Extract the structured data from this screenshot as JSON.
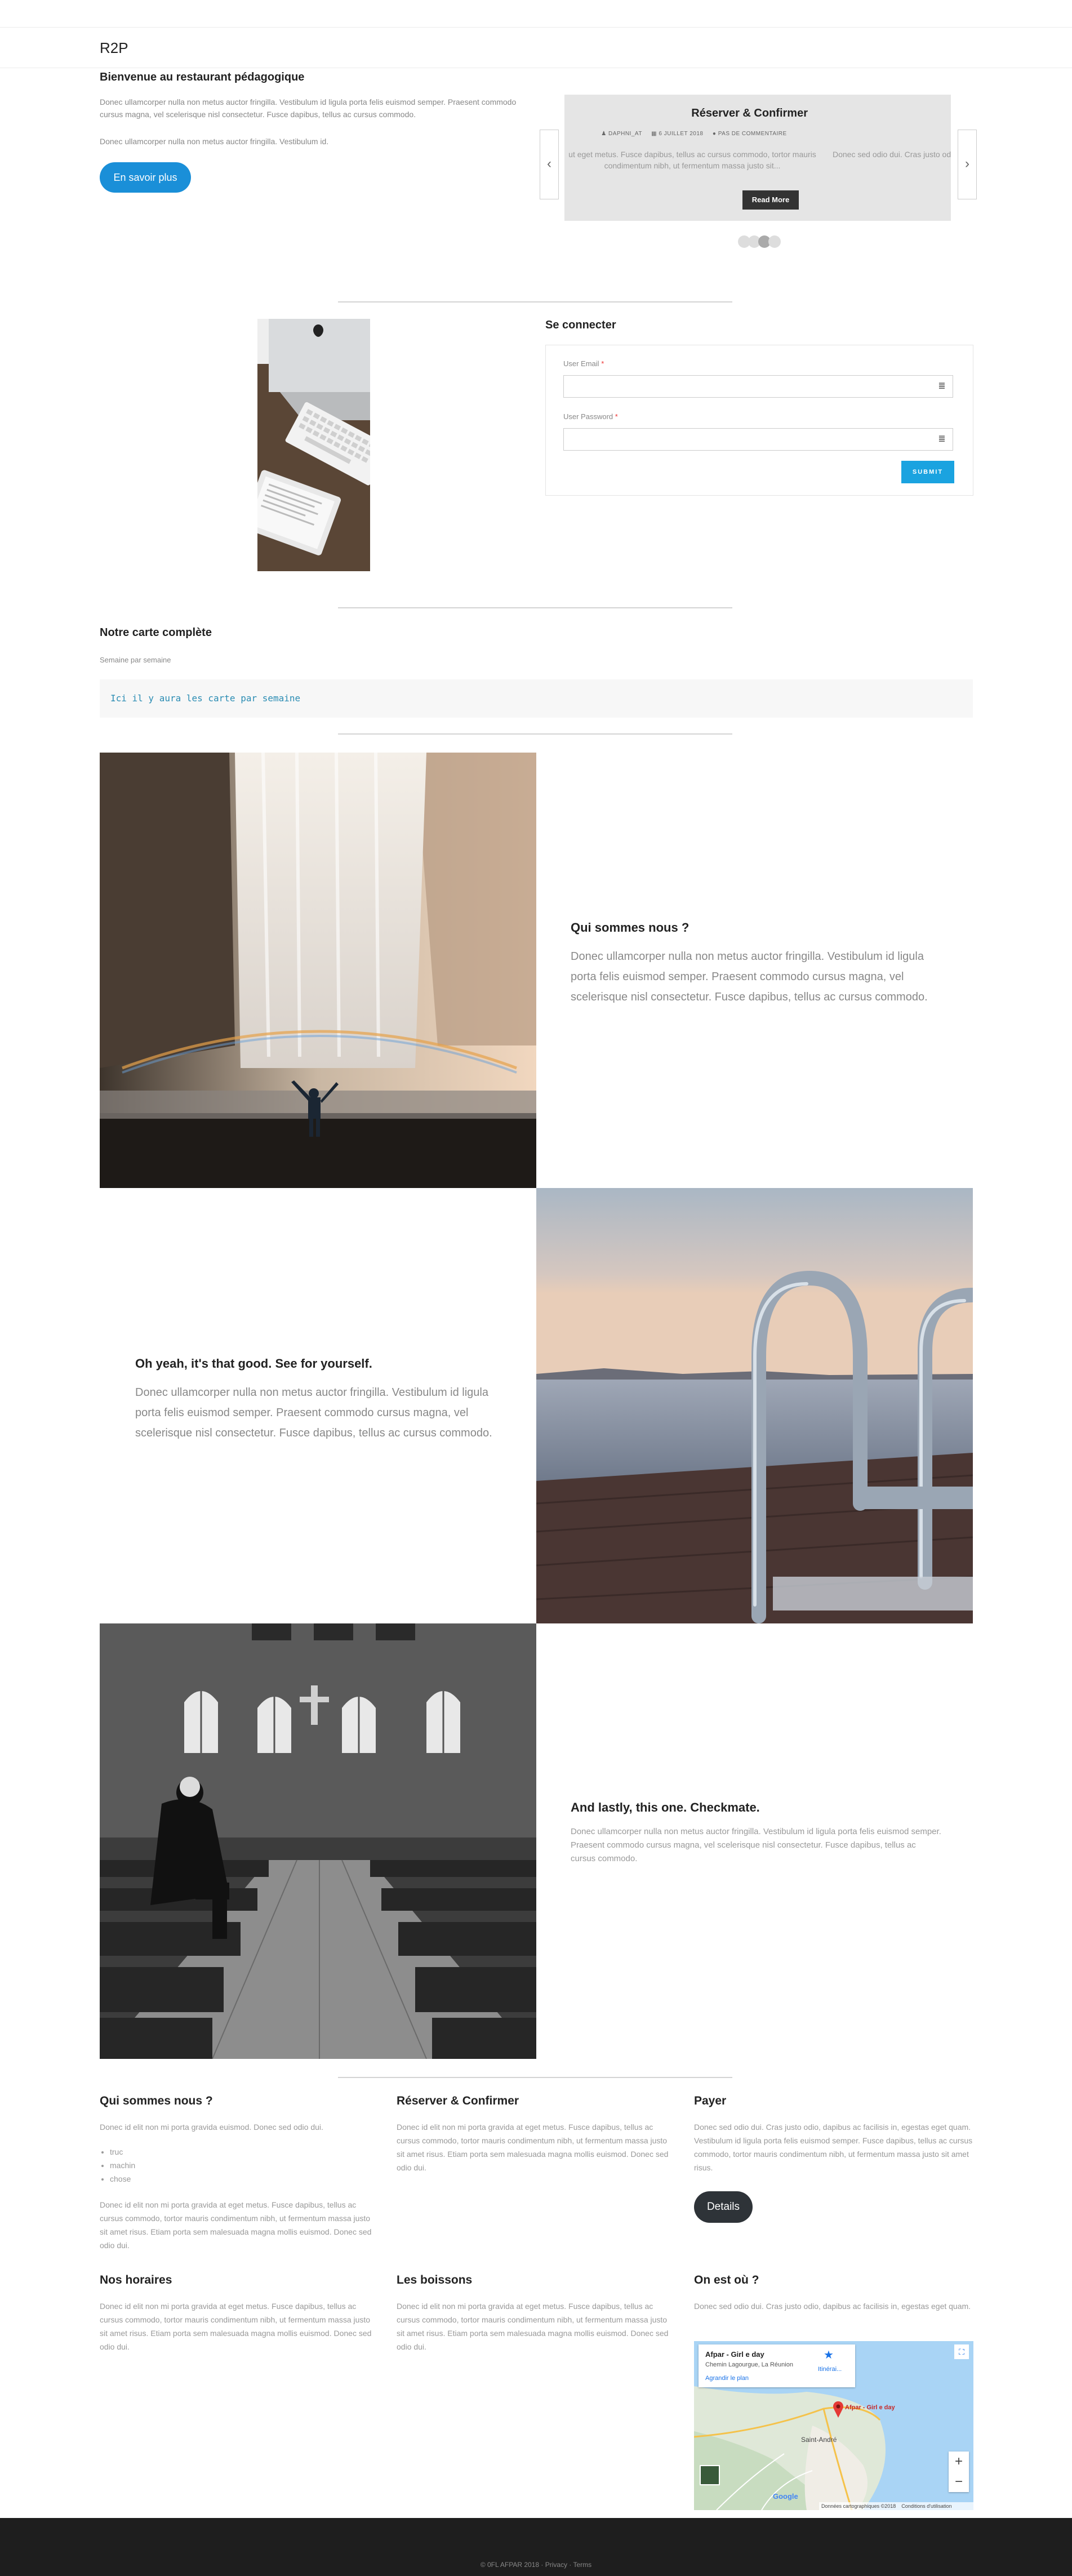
{
  "header": {
    "logo": "R2P"
  },
  "welcome": {
    "title": "Bienvenue au restaurant pédagogique",
    "para1": "Donec ullamcorper nulla non metus auctor fringilla. Vestibulum id ligula porta felis euismod semper. Praesent commodo cursus magna, vel scelerisque nisl consectetur. Fusce dapibus, tellus ac cursus commodo.",
    "para2": "Donec ullamcorper nulla non metus auctor fringilla. Vestibulum id.",
    "button": "En savoir plus"
  },
  "carousel": {
    "prev_icon": "chevron-left-icon",
    "next_icon": "chevron-right-icon",
    "slide_left_text": "a id eget metus.",
    "slide": {
      "title": "Réserver & Confirmer",
      "author": "DAPHNI_AT",
      "date": "6 JUILLET 2018",
      "comments": "PAS DE COMMENTAIRE",
      "text": "ut eget metus. Fusce dapibus, tellus ac cursus commodo, tortor mauris condimentum nibh, ut fermentum massa justo sit...",
      "read_more": "Read More"
    },
    "slide_right_text": "Donec sed odio dui. Cras justo odio"
  },
  "login": {
    "title": "Se connecter",
    "email_label": "User Email",
    "password_label": "User Password",
    "required_mark": "*",
    "submit": "SUBMIT"
  },
  "carte": {
    "title": "Notre carte complète",
    "subtitle": "Semaine par semaine",
    "code": "Ici il y aura les carte par semaine"
  },
  "features": [
    {
      "title": "Qui sommes nous ?",
      "text": "Donec ullamcorper nulla non metus auctor fringilla. Vestibulum id ligula porta felis euismod semper. Praesent commodo cursus magna, vel scelerisque nisl consectetur. Fusce dapibus, tellus ac cursus commodo."
    },
    {
      "title": "Oh yeah, it's that good. See for yourself.",
      "text": "Donec ullamcorper nulla non metus auctor fringilla. Vestibulum id ligula porta felis euismod semper. Praesent commodo cursus magna, vel scelerisque nisl consectetur. Fusce dapibus, tellus ac cursus commodo."
    },
    {
      "title": "And lastly, this one. Checkmate.",
      "text": "Donec ullamcorper nulla non metus auctor fringilla. Vestibulum id ligula porta felis euismod semper. Praesent commodo cursus magna, vel scelerisque nisl consectetur. Fusce dapibus, tellus ac cursus commodo."
    }
  ],
  "widgets": {
    "qui": {
      "title": "Qui sommes nous ?",
      "text1": "Donec id elit non mi porta gravida euismod. Donec sed odio dui.",
      "bullets": [
        "truc",
        "machin",
        "chose"
      ],
      "text2": "Donec id elit non mi porta gravida at eget metus. Fusce dapibus, tellus ac cursus commodo, tortor mauris condimentum nibh, ut fermentum massa justo sit amet risus. Etiam porta sem malesuada magna mollis euismod. Donec sed odio dui."
    },
    "reserver": {
      "title": "Réserver & Confirmer",
      "text": "Donec id elit non mi porta gravida at eget metus. Fusce dapibus, tellus ac cursus commodo, tortor mauris condimentum nibh, ut fermentum massa justo sit amet risus. Etiam porta sem malesuada magna mollis euismod. Donec sed odio dui."
    },
    "payer": {
      "title": "Payer",
      "text": "Donec sed odio dui. Cras justo odio, dapibus ac facilisis in, egestas eget quam. Vestibulum id ligula porta felis euismod semper. Fusce dapibus, tellus ac cursus commodo, tortor mauris condimentum nibh, ut fermentum massa justo sit amet risus.",
      "button": "Details"
    },
    "horaires": {
      "title": "Nos horaires",
      "text": "Donec id elit non mi porta gravida at eget metus. Fusce dapibus, tellus ac cursus commodo, tortor mauris condimentum nibh, ut fermentum massa justo sit amet risus. Etiam porta sem malesuada magna mollis euismod. Donec sed odio dui."
    },
    "boissons": {
      "title": "Les boissons",
      "text": "Donec id elit non mi porta gravida at eget metus. Fusce dapibus, tellus ac cursus commodo, tortor mauris condimentum nibh, ut fermentum massa justo sit amet risus. Etiam porta sem malesuada magna mollis euismod. Donec sed odio dui."
    },
    "ou": {
      "title": "On est où ?",
      "text": "Donec sed odio dui. Cras justo odio, dapibus ac facilisis in, egestas eget quam."
    }
  },
  "map": {
    "place_name": "Afpar - Girl e day",
    "address": "Chemin Lagourgue, La Réunion",
    "directions": "Itinérai...",
    "enlarge": "Agrandir le plan",
    "pin_label": "Afpar - Girl e day",
    "town": "Saint-André",
    "zoom_in": "+",
    "zoom_out": "−",
    "attribution": "Données cartographiques ©2018",
    "terms": "Conditions d'utilisation",
    "brand": "Google"
  },
  "footer": {
    "text": "© 0FL AFPAR 2018 · Privacy · Terms"
  },
  "colors": {
    "accent": "#1a8fd8",
    "submit": "#1aa3e0",
    "dark_button": "#2e3338",
    "footer_bg": "#1e1e1e"
  }
}
